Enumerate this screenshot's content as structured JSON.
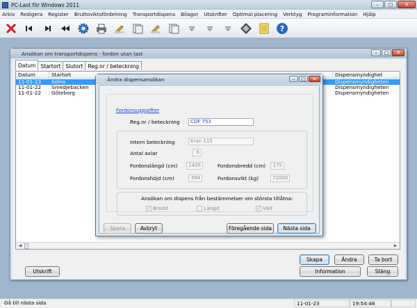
{
  "app": {
    "title": "PC-Last för Windows 2011"
  },
  "menu": [
    "Arkiv",
    "Redigera",
    "Register",
    "Bruttoviktsfördelning",
    "Transportdispens",
    "Bilagor",
    "Utskrifter",
    "Optimal placering",
    "Verktyg",
    "Programinformation",
    "Hjälp"
  ],
  "toolbar": {
    "icons": [
      "close-x-icon",
      "first-record-icon",
      "next-record-icon",
      "rewind-icon",
      "settings-gear-icon",
      "printer-icon",
      "edit-pencil-icon",
      "document-stack-icon",
      "edit-pencil-icon",
      "document-stack-icon",
      "arrow-down-icon",
      "arrow-down-icon",
      "arrow-down-icon",
      "calculator-icon",
      "notepad-icon",
      "help-icon"
    ]
  },
  "child": {
    "title": "Ansökan om transportdispens - fordon utan last",
    "tabs": [
      "Datum",
      "Startort",
      "Slutort",
      "Reg.nr / beteckning"
    ],
    "columns": {
      "datum": "Datum",
      "startort": "Startort",
      "dispens": "Dispensmyndighet"
    },
    "rows": [
      {
        "datum": "11-01-23",
        "startort": "Solna",
        "dispens": "Dispensmyndigheten"
      },
      {
        "datum": "11-01-22",
        "startort": "Smedjebacken",
        "dispens": "Dispensmyndigheten"
      },
      {
        "datum": "11-01-22",
        "startort": "Göteborg",
        "dispens": "Dispensmyndigheten"
      }
    ],
    "buttons": {
      "skapa": "Skapa",
      "andra": "Ändra",
      "tabort": "Ta bort",
      "utskrift": "Utskrift",
      "information": "Information",
      "stang": "Stäng"
    }
  },
  "dialog": {
    "title": "Ändra dispensansökan",
    "section_link": "Fordonsuppgifter",
    "regnr_label": "Reg.nr / beteckning",
    "regnr_value": "CDF 753",
    "intern_label": "Intern beteckning",
    "intern_value": "Kran 115",
    "axlar_label": "Antal axlar",
    "axlar_value": "6",
    "langd_label": "Fordonslängd (cm)",
    "langd_value": "1405",
    "bredd_label": "Fordonsbredd (cm)",
    "bredd_value": "275",
    "hojd_label": "Fordonshöjd (cm)",
    "hojd_value": "394",
    "vikt_label": "Fordonsvikt (kg)",
    "vikt_value": "72000",
    "exempt_label": "Ansökan om dispens från bestämmelser om största tillåtna:",
    "chk_bredd": "Bredd",
    "chk_langd": "Längd",
    "chk_vikt": "Vikt",
    "btn_spara": "Spara",
    "btn_avbryt": "Avbryt",
    "btn_foreg": "Föregående sida",
    "btn_nasta": "Nästa sida"
  },
  "status": {
    "message": "Gå till nästa sida",
    "date": "11-01-23",
    "time": "19:54:48"
  }
}
